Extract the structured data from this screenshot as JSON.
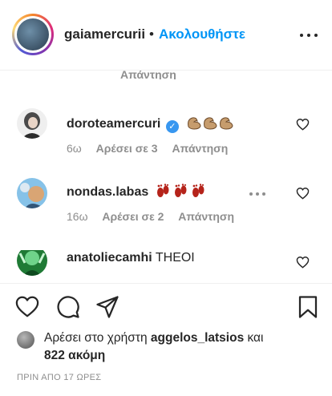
{
  "header": {
    "username": "gaiamercurii",
    "separator": "•",
    "follow_label": "Ακολουθήστε",
    "more_icon": "more-horizontal-icon"
  },
  "partial_reply": "Απάντηση",
  "comments": [
    {
      "username": "doroteamercuri",
      "verified": true,
      "text": "💪💪💪",
      "time": "6ω",
      "likes": "Αρέσει σε 3",
      "reply": "Απάντηση"
    },
    {
      "username": "nondas.labas",
      "verified": false,
      "text": "👣👣👣",
      "time": "16ω",
      "likes": "Αρέσει σε 2",
      "reply": "Απάντηση"
    },
    {
      "username": "anatoliecamhi",
      "verified": false,
      "text": "THEOI"
    }
  ],
  "actions": {
    "like_icon": "heart-icon",
    "comment_icon": "comment-icon",
    "share_icon": "share-icon",
    "save_icon": "bookmark-icon"
  },
  "likes": {
    "prefix": "Αρέσει στο χρήστη",
    "user": "aggelos_latsios",
    "conjunction": "και",
    "others": "822 ακόμη"
  },
  "time_ago": "ΠΡΙΝ ΑΠΟ 17 ΩΡΕΣ",
  "colors": {
    "accent": "#0095f6",
    "text": "#262626",
    "muted": "#8e8e8e",
    "verified": "#3897f0"
  }
}
